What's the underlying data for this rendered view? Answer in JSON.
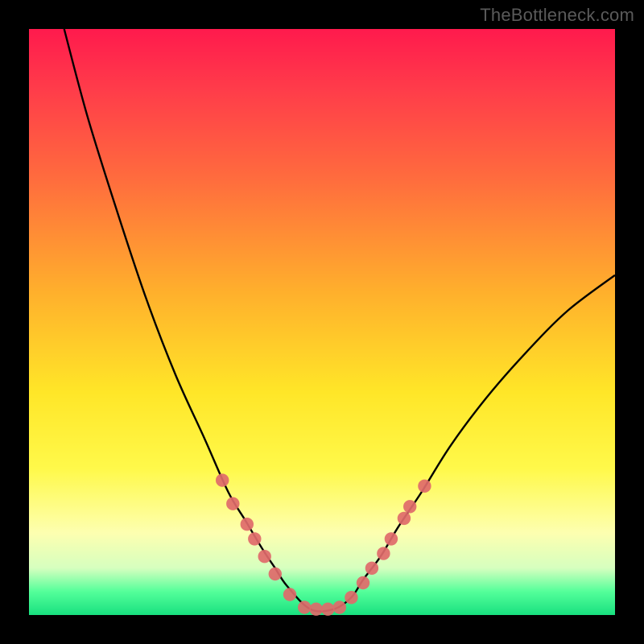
{
  "watermark": "TheBottleneck.com",
  "colors": {
    "background": "#000000",
    "gradient_top": "#ff1a4d",
    "gradient_bottom": "#18e07f",
    "curve": "#000000",
    "dots": "#e06a6a"
  },
  "chart_data": {
    "type": "line",
    "title": "",
    "xlabel": "",
    "ylabel": "",
    "xlim": [
      0,
      100
    ],
    "ylim": [
      0,
      100
    ],
    "series": [
      {
        "name": "bottleneck-curve",
        "x": [
          6,
          10,
          15,
          20,
          25,
          30,
          34,
          37,
          40,
          42,
          44,
          48,
          52,
          55,
          57,
          60,
          63,
          67,
          72,
          78,
          85,
          92,
          100
        ],
        "y": [
          100,
          85,
          69,
          54,
          41,
          30,
          21,
          16,
          11,
          8,
          5,
          1,
          1,
          3,
          6,
          10,
          15,
          21,
          29,
          37,
          45,
          52,
          58
        ]
      }
    ],
    "dots": {
      "name": "highlight-dots",
      "points": [
        {
          "x": 33.0,
          "y": 23.0
        },
        {
          "x": 34.8,
          "y": 19.0
        },
        {
          "x": 37.2,
          "y": 15.5
        },
        {
          "x": 38.5,
          "y": 13.0
        },
        {
          "x": 40.2,
          "y": 10.0
        },
        {
          "x": 42.0,
          "y": 7.0
        },
        {
          "x": 44.5,
          "y": 3.5
        },
        {
          "x": 47.0,
          "y": 1.3
        },
        {
          "x": 49.0,
          "y": 1.0
        },
        {
          "x": 51.0,
          "y": 1.0
        },
        {
          "x": 53.0,
          "y": 1.3
        },
        {
          "x": 55.0,
          "y": 3.0
        },
        {
          "x": 57.0,
          "y": 5.5
        },
        {
          "x": 58.5,
          "y": 8.0
        },
        {
          "x": 60.5,
          "y": 10.5
        },
        {
          "x": 61.8,
          "y": 13.0
        },
        {
          "x": 64.0,
          "y": 16.5
        },
        {
          "x": 65.0,
          "y": 18.5
        },
        {
          "x": 67.5,
          "y": 22.0
        }
      ]
    }
  }
}
